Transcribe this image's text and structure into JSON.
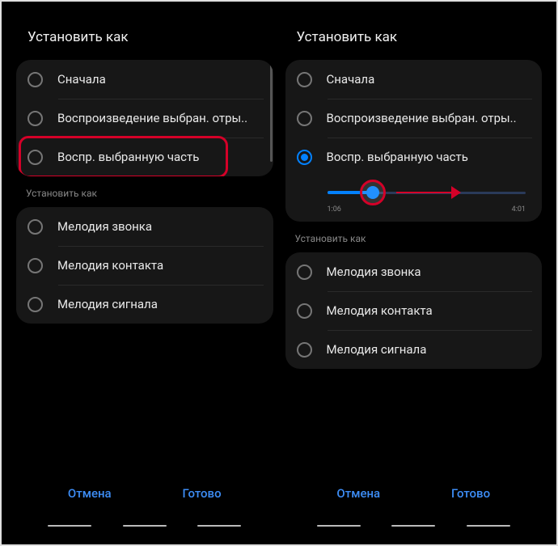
{
  "left": {
    "title": "Установить как",
    "section1": [
      {
        "label": "Сначала",
        "checked": false
      },
      {
        "label": "Воспроизведение выбран. отры..",
        "checked": false
      },
      {
        "label": "Воспр. выбранную часть",
        "checked": false,
        "highlighted": true
      }
    ],
    "subheader": "Установить как",
    "section2": [
      {
        "label": "Мелодия звонка",
        "checked": false
      },
      {
        "label": "Мелодия контакта",
        "checked": false
      },
      {
        "label": "Мелодия сигнала",
        "checked": false
      }
    ]
  },
  "right": {
    "title": "Установить как",
    "section1": [
      {
        "label": "Сначала",
        "checked": false
      },
      {
        "label": "Воспроизведение выбран. отры..",
        "checked": false
      },
      {
        "label": "Воспр. выбранную часть",
        "checked": true
      }
    ],
    "slider": {
      "start": "1:06",
      "end": "4:01"
    },
    "subheader": "Установить как",
    "section2": [
      {
        "label": "Мелодия звонка",
        "checked": false
      },
      {
        "label": "Мелодия контакта",
        "checked": false
      },
      {
        "label": "Мелодия сигнала",
        "checked": false
      }
    ]
  },
  "buttons": {
    "cancel": "Отмена",
    "done": "Готово"
  }
}
